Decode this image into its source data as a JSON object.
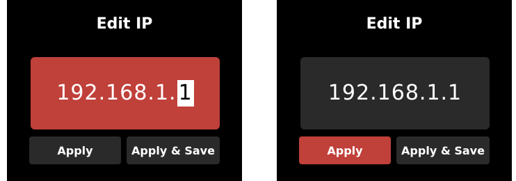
{
  "colors": {
    "accent": "#c0403a",
    "panel": "#2a2a2a",
    "background": "#000000",
    "text": "#ffffff"
  },
  "screens": [
    {
      "title": "Edit IP",
      "ip_prefix": "192.168.1.",
      "ip_cursor_char": "1",
      "ip_box_state": "selected",
      "buttons": {
        "apply_label": "Apply",
        "apply_save_label": "Apply & Save"
      },
      "focused_button": "none"
    },
    {
      "title": "Edit IP",
      "ip_value": "192.168.1.1",
      "ip_box_state": "normal",
      "buttons": {
        "apply_label": "Apply",
        "apply_save_label": "Apply & Save"
      },
      "focused_button": "apply"
    }
  ]
}
